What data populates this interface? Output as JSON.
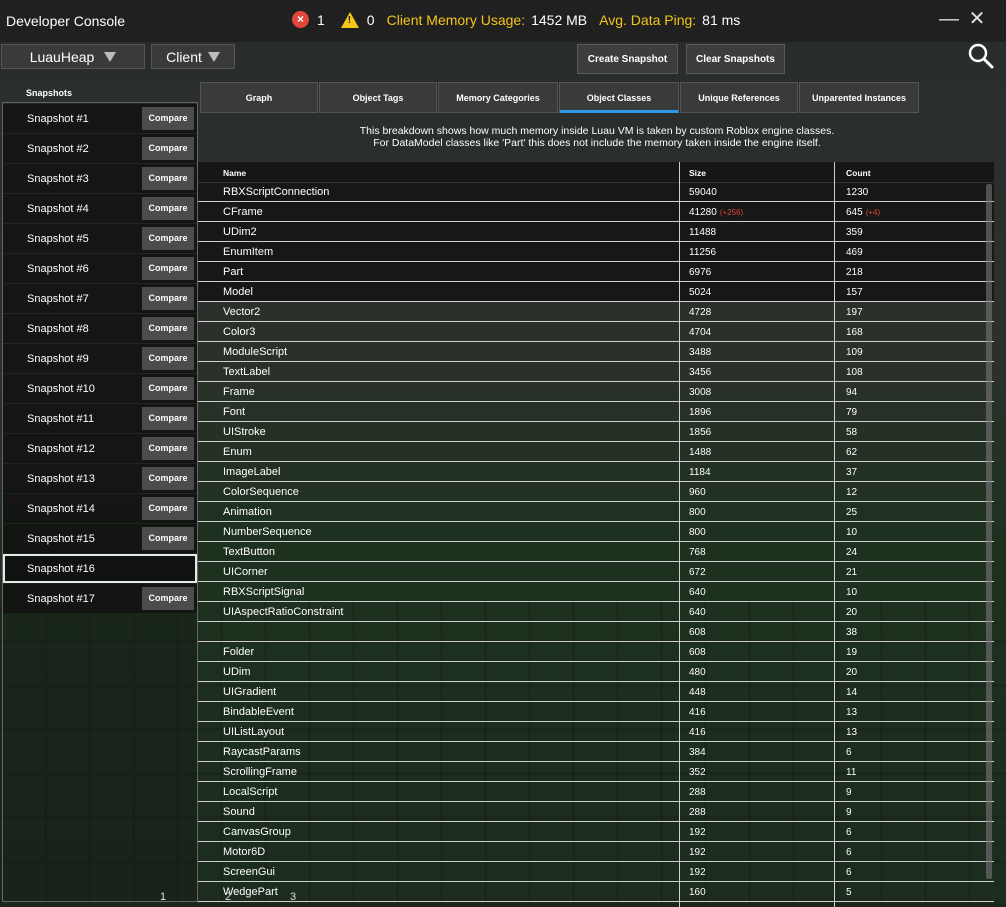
{
  "window": {
    "title": "Developer Console"
  },
  "status": {
    "errors": "1",
    "warnings": "0",
    "memory_label": "Client Memory Usage:",
    "memory_value": "1452 MB",
    "ping_label": "Avg. Data Ping:",
    "ping_value": "81 ms"
  },
  "toolbar": {
    "mode_select": "LuauHeap",
    "target_select": "Client",
    "create_snapshot": "Create Snapshot",
    "clear_snapshots": "Clear Snapshots"
  },
  "snapshots": {
    "header": "Snapshots",
    "compare_label": "Compare",
    "items": [
      "Snapshot #1",
      "Snapshot #2",
      "Snapshot #3",
      "Snapshot #4",
      "Snapshot #5",
      "Snapshot #6",
      "Snapshot #7",
      "Snapshot #8",
      "Snapshot #9",
      "Snapshot #10",
      "Snapshot #11",
      "Snapshot #12",
      "Snapshot #13",
      "Snapshot #14",
      "Snapshot #15",
      "Snapshot #16",
      "Snapshot #17"
    ],
    "selected": "Snapshot #16"
  },
  "tabs": [
    "Graph",
    "Object Tags",
    "Memory Categories",
    "Object Classes",
    "Unique References",
    "Unparented Instances"
  ],
  "active_tab": "Object Classes",
  "description": {
    "line1": "This breakdown shows how much memory inside Luau VM is taken by custom Roblox engine classes.",
    "line2": "For DataModel classes like 'Part' this does not include the memory taken inside the engine itself."
  },
  "table": {
    "headers": {
      "name": "Name",
      "size": "Size",
      "count": "Count"
    },
    "rows": [
      {
        "name": "RBXScriptConnection",
        "size": "59040",
        "count": "1230"
      },
      {
        "name": "CFrame",
        "size": "41280",
        "size_delta": "(+256)",
        "count": "645",
        "count_delta": "(+4)"
      },
      {
        "name": "UDim2",
        "size": "11488",
        "count": "359"
      },
      {
        "name": "EnumItem",
        "size": "11256",
        "count": "469"
      },
      {
        "name": "Part",
        "size": "6976",
        "count": "218"
      },
      {
        "name": "Model",
        "size": "5024",
        "count": "157"
      },
      {
        "name": "Vector2",
        "size": "4728",
        "count": "197"
      },
      {
        "name": "Color3",
        "size": "4704",
        "count": "168"
      },
      {
        "name": "ModuleScript",
        "size": "3488",
        "count": "109"
      },
      {
        "name": "TextLabel",
        "size": "3456",
        "count": "108"
      },
      {
        "name": "Frame",
        "size": "3008",
        "count": "94"
      },
      {
        "name": "Font",
        "size": "1896",
        "count": "79"
      },
      {
        "name": "UIStroke",
        "size": "1856",
        "count": "58"
      },
      {
        "name": "Enum",
        "size": "1488",
        "count": "62"
      },
      {
        "name": "ImageLabel",
        "size": "1184",
        "count": "37"
      },
      {
        "name": "ColorSequence",
        "size": "960",
        "count": "12"
      },
      {
        "name": "Animation",
        "size": "800",
        "count": "25"
      },
      {
        "name": "NumberSequence",
        "size": "800",
        "count": "10"
      },
      {
        "name": "TextButton",
        "size": "768",
        "count": "24"
      },
      {
        "name": "UICorner",
        "size": "672",
        "count": "21"
      },
      {
        "name": "RBXScriptSignal",
        "size": "640",
        "count": "10"
      },
      {
        "name": "UIAspectRatioConstraint",
        "size": "640",
        "count": "20"
      },
      {
        "name": "",
        "size": "608",
        "count": "38"
      },
      {
        "name": "Folder",
        "size": "608",
        "count": "19"
      },
      {
        "name": "UDim",
        "size": "480",
        "count": "20"
      },
      {
        "name": "UIGradient",
        "size": "448",
        "count": "14"
      },
      {
        "name": "BindableEvent",
        "size": "416",
        "count": "13"
      },
      {
        "name": "UIListLayout",
        "size": "416",
        "count": "13"
      },
      {
        "name": "RaycastParams",
        "size": "384",
        "count": "6"
      },
      {
        "name": "ScrollingFrame",
        "size": "352",
        "count": "11"
      },
      {
        "name": "LocalScript",
        "size": "288",
        "count": "9"
      },
      {
        "name": "Sound",
        "size": "288",
        "count": "9"
      },
      {
        "name": "CanvasGroup",
        "size": "192",
        "count": "6"
      },
      {
        "name": "Motor6D",
        "size": "192",
        "count": "6"
      },
      {
        "name": "ScreenGui",
        "size": "192",
        "count": "6"
      },
      {
        "name": "WedgePart",
        "size": "160",
        "count": "5"
      }
    ]
  },
  "pager": [
    "1",
    "2",
    "3"
  ],
  "colors": {
    "accent": "#2b9be8",
    "warning": "#f5c518",
    "error": "#e0463c",
    "delta": "#e0463c"
  }
}
